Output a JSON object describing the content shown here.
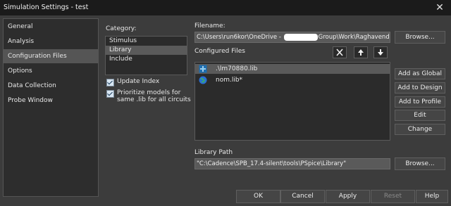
{
  "window": {
    "title": "Simulation Settings - test"
  },
  "nav": {
    "items": [
      {
        "label": "General"
      },
      {
        "label": "Analysis"
      },
      {
        "label": "Configuration Files"
      },
      {
        "label": "Options"
      },
      {
        "label": "Data Collection"
      },
      {
        "label": "Probe Window"
      }
    ],
    "selected": "Configuration Files"
  },
  "category": {
    "label": "Category:",
    "items": [
      "Stimulus",
      "Library",
      "Include"
    ],
    "selected": "Library"
  },
  "checkboxes": {
    "update_index": {
      "label": "Update Index",
      "checked": true
    },
    "prioritize": {
      "label": "Prioritize models for same .lib for all circuits",
      "checked": true
    }
  },
  "filename": {
    "label": "Filename:",
    "value_start": "C:\\Users\\run6kor\\OneDrive - ",
    "value_end": "Group\\Work\\Raghavendra_K_S\\Ru",
    "browse": "Browse..."
  },
  "configured": {
    "label": "Configured Files",
    "files": [
      {
        "name": ".\\lm70880.lib",
        "icon": "local-lib-icon"
      },
      {
        "name": "nom.lib*",
        "icon": "global-lib-icon"
      }
    ],
    "selected": ".\\lm70880.lib"
  },
  "side_buttons": {
    "add_global": "Add as Global",
    "add_design": "Add to Design",
    "add_profile": "Add to Profile",
    "edit": "Edit",
    "change": "Change"
  },
  "library_path": {
    "label": "Library Path",
    "value": "\"C:\\Cadence\\SPB_17.4-silent\\tools\\PSpice\\Library\"",
    "browse": "Browse..."
  },
  "footer": {
    "ok": "OK",
    "cancel": "Cancel",
    "apply": "Apply",
    "reset": "Reset",
    "help": "Help"
  },
  "colors": {
    "background": "#3c3c3c",
    "titlebar": "#1b1b1b",
    "selection": "#5a5a5a"
  }
}
